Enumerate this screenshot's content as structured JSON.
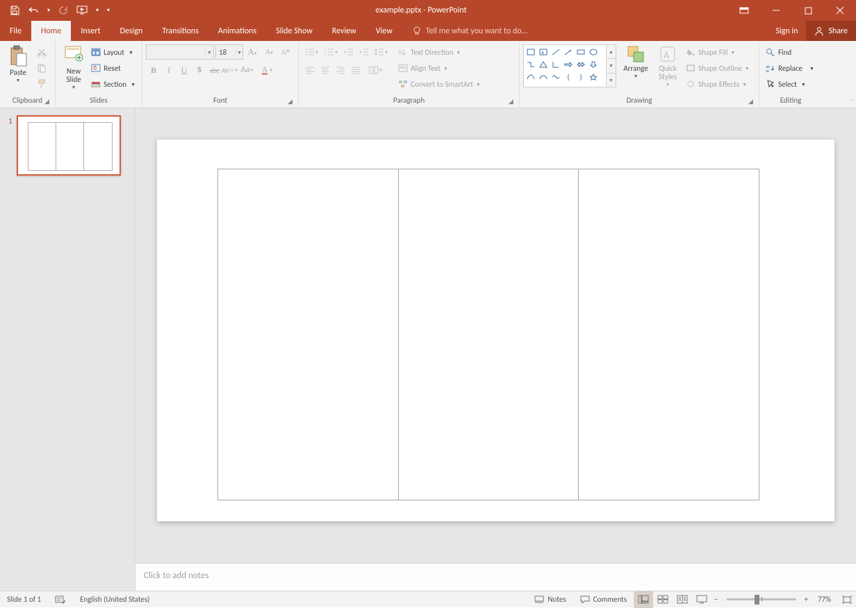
{
  "app": {
    "title": "example.pptx - PowerPoint"
  },
  "qat": {
    "save": "Save",
    "undo": "Undo",
    "redo": "Redo",
    "start": "Start From Beginning",
    "customize": "Customize Quick Access Toolbar"
  },
  "window": {
    "ribbon_opts": "Ribbon Display Options",
    "min": "Minimize",
    "max": "Maximize",
    "close": "Close"
  },
  "tabs": {
    "file": "File",
    "home": "Home",
    "insert": "Insert",
    "design": "Design",
    "transitions": "Transitions",
    "animations": "Animations",
    "slideshow": "Slide Show",
    "review": "Review",
    "view": "View",
    "tell_placeholder": "Tell me what you want to do...",
    "signin": "Sign in",
    "share": "Share"
  },
  "ribbon": {
    "clipboard": {
      "label": "Clipboard",
      "paste": "Paste",
      "cut": "Cut",
      "copy": "Copy",
      "format_painter": "Format Painter"
    },
    "slides": {
      "label": "Slides",
      "new_slide": "New\nSlide",
      "layout": "Layout",
      "reset": "Reset",
      "section": "Section"
    },
    "font": {
      "label": "Font",
      "font_name": "",
      "font_size": "18",
      "bold": "B",
      "italic": "I",
      "underline": "U",
      "shadow": "S",
      "strike": "abc",
      "spacing": "AV",
      "case": "Aa",
      "clear": "Clear Formatting",
      "color": "A",
      "grow": "A",
      "shrink": "A"
    },
    "paragraph": {
      "label": "Paragraph",
      "text_direction": "Text Direction",
      "align_text": "Align Text",
      "smartart": "Convert to SmartArt"
    },
    "drawing": {
      "label": "Drawing",
      "arrange": "Arrange",
      "quick_styles": "Quick\nStyles",
      "shape_fill": "Shape Fill",
      "shape_outline": "Shape Outline",
      "shape_effects": "Shape Effects"
    },
    "editing": {
      "label": "Editing",
      "find": "Find",
      "replace": "Replace",
      "select": "Select"
    }
  },
  "thumbs": {
    "slide1_num": "1"
  },
  "notes": {
    "placeholder": "Click to add notes"
  },
  "status": {
    "slide": "Slide 1 of 1",
    "lang": "English (United States)",
    "notes": "Notes",
    "comments": "Comments",
    "zoom": "77%",
    "views": {
      "normal": "Normal",
      "sorter": "Slide Sorter",
      "reading": "Reading View",
      "slideshow": "Slide Show"
    }
  }
}
